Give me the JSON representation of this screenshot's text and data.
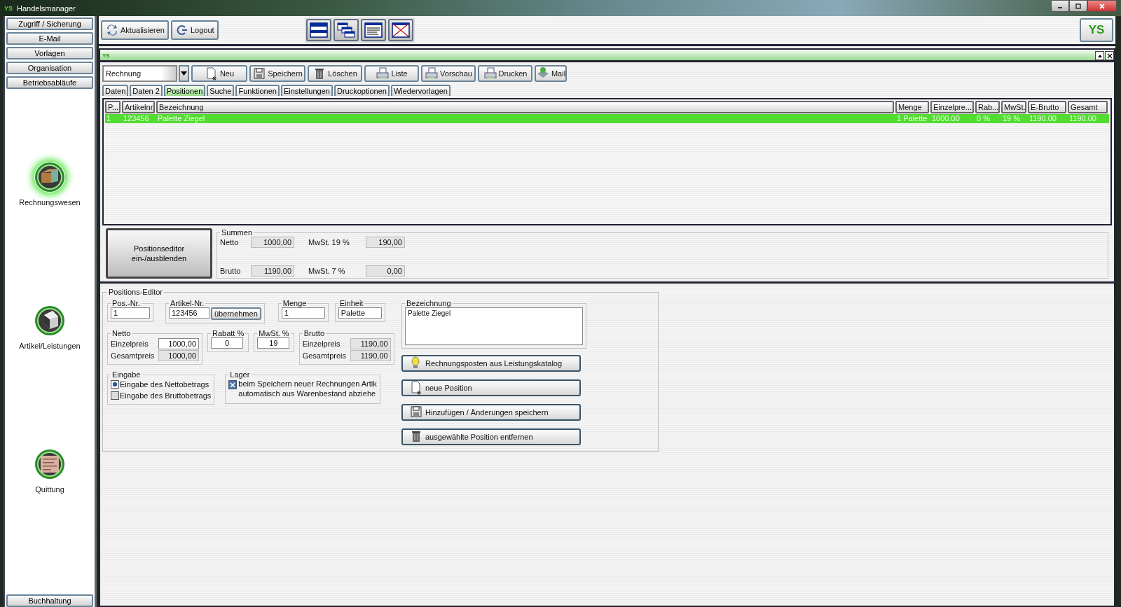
{
  "window": {
    "logo": "YS",
    "title": "Handelsmanager"
  },
  "sidebar": {
    "top_buttons": [
      "Zugriff / Sicherung",
      "E-Mail",
      "Vorlagen",
      "Organisation",
      "Betriebsabläufe"
    ],
    "modules": [
      {
        "label": "Rechnungswesen",
        "selected": true
      },
      {
        "label": "Artikel/Leistungen",
        "selected": false
      },
      {
        "label": "Quittung",
        "selected": false
      }
    ],
    "bottom_button": "Buchhaltung"
  },
  "toolbar": {
    "buttons": [
      "Aktualisieren",
      "Logout"
    ],
    "brand": "YS"
  },
  "panel": {
    "title": "YS",
    "document_type": "Rechnung",
    "actions": [
      "Neu",
      "Speichern",
      "Löschen",
      "Liste",
      "Vorschau",
      "Drucken",
      "Mail"
    ],
    "tabs": [
      {
        "label": "Daten",
        "selected": false
      },
      {
        "label": "Daten 2",
        "selected": false
      },
      {
        "label": "Positionen",
        "selected": true
      },
      {
        "label": "Suche",
        "selected": false
      },
      {
        "label": "Funktionen",
        "selected": false
      },
      {
        "label": "Einstellungen",
        "selected": false
      },
      {
        "label": "Druckoptionen",
        "selected": false
      },
      {
        "label": "Wiedervorlagen",
        "selected": false
      }
    ],
    "table": {
      "columns": [
        "P...",
        "Artikelnr.",
        "Bezeichnung",
        "Menge",
        "Einzelpre...",
        "Rab...",
        "MwSt.",
        "E-Brutto",
        "Gesamt"
      ],
      "rows": [
        {
          "selected": true,
          "cells": [
            "1",
            "123456",
            "Palette Ziegel",
            "1 Palette",
            "1000.00",
            "0 %",
            "19 %",
            "1190.00",
            "1190.00"
          ]
        }
      ]
    },
    "toggle_button": [
      "Positionseditor",
      "ein-/ausblenden"
    ],
    "summen": {
      "title": "Summen",
      "rows": [
        {
          "label": "Netto",
          "value": "1000,00",
          "tax_label": "MwSt. 19 %",
          "tax_value": "190,00"
        },
        {
          "label": "Brutto",
          "value": "1190,00",
          "tax_label": "MwSt. 7 %",
          "tax_value": "0,00"
        }
      ]
    }
  },
  "editor": {
    "title": "Positions-Editor",
    "pos_nr": {
      "label": "Pos.-Nr.",
      "value": "1"
    },
    "artikel_nr": {
      "label": "Artikel-Nr.",
      "value": "123456",
      "button": "übernehmen"
    },
    "menge": {
      "label": "Menge",
      "value": "1"
    },
    "einheit": {
      "label": "Einheit",
      "value": "Palette"
    },
    "netto": {
      "title": "Netto",
      "rows": [
        {
          "label": "Einzelpreis",
          "value": "1000,00",
          "editable": true
        },
        {
          "label": "Gesamtpreis",
          "value": "1000,00",
          "editable": false
        }
      ]
    },
    "rabatt": {
      "label": "Rabatt %",
      "value": "0"
    },
    "mwst": {
      "label": "MwSt. %",
      "value": "19"
    },
    "brutto": {
      "title": "Brutto",
      "rows": [
        {
          "label": "Einzelpreis",
          "value": "1190,00",
          "editable": false
        },
        {
          "label": "Gesamtpreis",
          "value": "1190,00",
          "editable": false
        }
      ]
    },
    "eingabe": {
      "title": "Eingabe",
      "options": [
        {
          "label": "Eingabe des Nettobetrags",
          "selected": true
        },
        {
          "label": "Eingabe des Bruttobetrags",
          "selected": false
        }
      ]
    },
    "lager": {
      "title": "Lager",
      "checked": true,
      "lines": [
        "beim Speichern neuer Rechnungen Artik",
        "automatisch aus Warenbestand abziehe"
      ]
    },
    "bezeichnung": {
      "label": "Bezeichnung",
      "value": "Palette Ziegel"
    },
    "buttons": [
      "Rechnungsposten aus Leistungskatalog",
      "neue Position",
      "Hinzufügen / Änderungen speichern",
      "ausgewählte Position entfernen"
    ]
  }
}
